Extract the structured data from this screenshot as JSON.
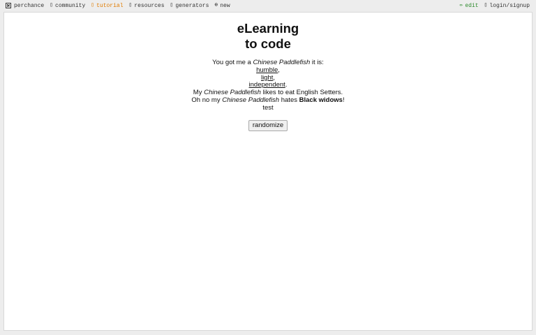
{
  "nav": {
    "brand": "perchance",
    "community": "community",
    "tutorial": "tutorial",
    "resources": "resources",
    "generators": "generators",
    "new": "new",
    "edit": "edit",
    "login": "login/signup",
    "tutorial_color": "#e07b00",
    "edit_color": "#2e8b2e"
  },
  "page": {
    "title_line1": "eLearning",
    "title_line2": "to code"
  },
  "output": {
    "line1_pre": "You got me a ",
    "animal": "Chinese Paddlefish",
    "line1_post": " it is:",
    "trait1": "humble",
    "trait2": "light",
    "trait3": "independent",
    "line5_pre": "My ",
    "line5_post": " likes to eat English Setters.",
    "line6_pre": "Oh no my ",
    "line6_mid": " hates ",
    "enemy": "Black widows",
    "line7": "test"
  },
  "controls": {
    "randomize_label": "randomize"
  }
}
